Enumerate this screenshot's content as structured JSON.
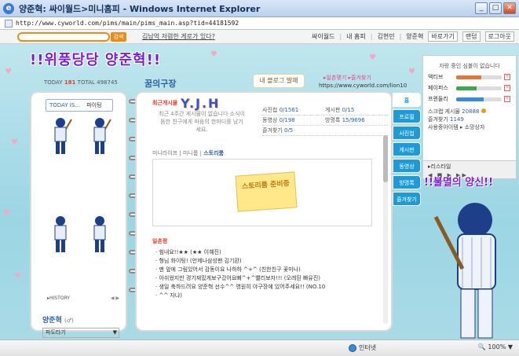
{
  "window": {
    "title": "양준혁: 싸이월드>미니홈피 - Windows Internet Explorer",
    "url": "http://www.cyworld.com/pims/main/pims_main.asp?tid=44181592",
    "buttons": {
      "minimize": "_",
      "maximize": "□",
      "close": "✕"
    }
  },
  "toolbar": {
    "search_button": "검색",
    "promo_link": "김남억 저렴한 게로가 있다?",
    "links": [
      "싸이월드",
      "내 홈피",
      "김현민",
      "양준혁",
      "바로가기",
      "랜덤",
      "로그아웃"
    ],
    "sep": "|"
  },
  "banner": {
    "name": "!!위풍당당 양준혁!!"
  },
  "counter": {
    "today_label": "TODAY",
    "today": "181",
    "total_label": "TOTAL",
    "total": "498745"
  },
  "section": {
    "title": "꿈의구장"
  },
  "board_tag": "내 블로그 발매",
  "pink_links": {
    "a": "▸일촌맺기",
    "b": "▸즐겨찾기"
  },
  "site_url": "https://www.cyworld.com/lion10",
  "left": {
    "today_is": "TODAY IS...",
    "mood": "파이팅",
    "history": "▸HISTORY",
    "history_arrows": "◀ ▶",
    "owner_name": "양준혁",
    "owner_gender": "(♂)",
    "friends_select": "파도타기",
    "select_arrow": "▼"
  },
  "main": {
    "recent_label": "최근게시물",
    "logo_text": "Y.J.H",
    "recent_msg": "최근 4주간 게시물이 없습니다 소식이 뜸한 친구에게 마음의 한마디를 남기세요.",
    "stats": [
      {
        "label": "사진첩",
        "value": "0/1561"
      },
      {
        "label": "게시판",
        "value": "0/15"
      },
      {
        "label": "동영상",
        "value": "0/198"
      },
      {
        "label": "방명록",
        "value": "15/9696"
      },
      {
        "label": "즐겨찾기",
        "value": "0/5"
      }
    ],
    "mini_links": {
      "a": "미니라이프",
      "sep": "|",
      "b": "미니룸",
      "c": "스토리룸"
    },
    "note": "스토리룸 준비중",
    "guest_label": "일촌평",
    "guestbook": [
      "· 힘내요!!★★ (★★ 이혜진)",
      "· 형님 화이팅! (언제나삼성팬 김기환)",
      "· 맨 앞에 그림있어서 감동이요 나하하 ^+^ (친한친구 꽃미나)",
      "· 아쉬웠지만 경기재밌게보구갔어요빠^+^빨리보자!!! (오레된 빠유진)",
      "· 생일 축하드려요 양준혁 선수^^ 영원히 야구장에 있어주세요!! (NO.10",
      "· ^^ 자냐)"
    ]
  },
  "tabs": [
    "홈",
    "프로필",
    "사진첩",
    "게시판",
    "동영상",
    "방명록",
    "즐겨찾기"
  ],
  "right": {
    "status": "자랑 중인 심볼이 없습니다",
    "meters": [
      {
        "label": "액티브",
        "value": 0.55,
        "color": "#e07a3a"
      },
      {
        "label": "페이퍼스",
        "value": 0.45,
        "color": "#3aa850"
      },
      {
        "label": "프렌들리",
        "value": 0.6,
        "color": "#3a8bd5"
      }
    ],
    "plus": "+",
    "scrap_label": "스크랩 게시물",
    "scrap_num": "20888",
    "fav_label": "즐겨찾기",
    "fav_num": "1149",
    "used_label": "사용중아이템 ▸",
    "used_value": "소망상자",
    "player_mode": "▸리스타일",
    "player_ctrls": "◀ ■ ▶ ▶▶"
  },
  "banner2": "!!불멸의 양신!!",
  "status": {
    "done": "",
    "zone": "인터넷",
    "zoom": "🔍 100%  ▼"
  }
}
